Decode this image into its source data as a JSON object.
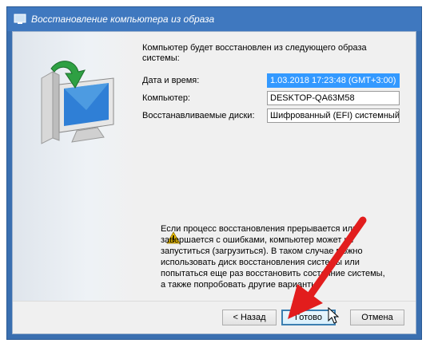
{
  "window": {
    "title": "Восстановление компьютера из образа"
  },
  "intro_text": "Компьютер будет восстановлен из следующего образа системы:",
  "fields": [
    {
      "label": "Дата и время:",
      "value": "1.03.2018 17:23:48 (GMT+3:00)"
    },
    {
      "label": "Компьютер:",
      "value": "DESKTOP-QA63M58"
    },
    {
      "label": "Восстанавливаемые диски:",
      "value": "Шифрованный (EFI) системный р"
    }
  ],
  "warning_text": "Если процесс восстановления прерывается или завершается с ошибками, компьютер может не запуститься (загрузиться). В таком случае можно использовать диск восстановления системы или попытаться еще раз восстановить состояние системы, а также попробовать другие варианты",
  "buttons": {
    "back": "< Назад",
    "finish": "Готово",
    "cancel": "Отмена"
  },
  "colors": {
    "title_bar": "#3f78bf",
    "selection": "#3399ff",
    "arrow": "#e21d1d"
  },
  "icons": [
    "window-app-icon",
    "computer-restore-icon",
    "warning-icon",
    "red-arrow-annotation",
    "mouse-cursor-icon"
  ]
}
